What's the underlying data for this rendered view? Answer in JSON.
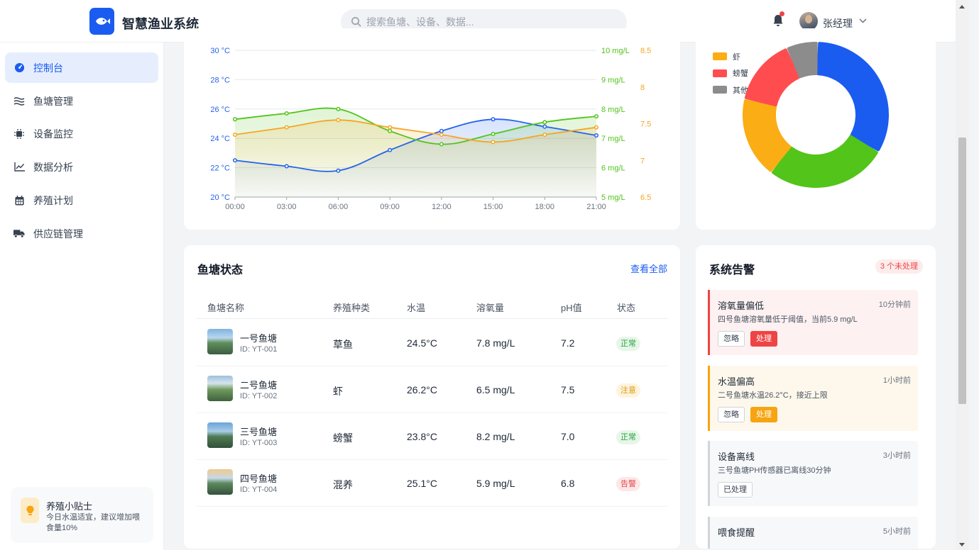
{
  "header": {
    "app_title": "智慧渔业系统",
    "search_placeholder": "搜索鱼塘、设备、数据...",
    "user_name": "张经理",
    "brand_color": "#1a5cf0"
  },
  "sidebar": {
    "items": [
      {
        "label": "控制台",
        "icon": "dashboard-icon",
        "active": true
      },
      {
        "label": "鱼塘管理",
        "icon": "water-waves-icon"
      },
      {
        "label": "设备监控",
        "icon": "chip-icon"
      },
      {
        "label": "数据分析",
        "icon": "line-chart-icon"
      },
      {
        "label": "养殖计划",
        "icon": "calendar-icon"
      },
      {
        "label": "供应链管理",
        "icon": "truck-icon"
      }
    ],
    "tip": {
      "title": "养殖小贴士",
      "text": "今日水温适宜，建议增加喂食量10%"
    }
  },
  "chart_data": [
    {
      "type": "line",
      "x": [
        "00:00",
        "03:00",
        "06:00",
        "09:00",
        "12:00",
        "15:00",
        "18:00",
        "21:00"
      ],
      "y_axes": {
        "temperature": {
          "ticks": [
            "20 °C",
            "22 °C",
            "24 °C",
            "26 °C",
            "28 °C",
            "30 °C"
          ],
          "range": [
            20,
            30
          ],
          "color": "#2563eb"
        },
        "oxygen": {
          "ticks": [
            "5 mg/L",
            "6 mg/L",
            "7 mg/L",
            "8 mg/L",
            "9 mg/L",
            "10 mg/L"
          ],
          "range": [
            5,
            10
          ],
          "color": "#52c41a"
        },
        "ph": {
          "ticks": [
            "6.5",
            "7",
            "7.5",
            "8",
            "8.5"
          ],
          "range": [
            6.5,
            8.5
          ],
          "color": "#f5a623"
        }
      },
      "series": [
        {
          "axis": "temperature",
          "color": "#2563eb",
          "values": [
            22.5,
            22.1,
            21.8,
            23.2,
            24.5,
            25.3,
            24.8,
            24.2
          ]
        },
        {
          "axis": "oxygen",
          "color": "#52c41a",
          "values": [
            7.65,
            7.85,
            8.0,
            7.25,
            6.8,
            7.15,
            7.55,
            7.75
          ]
        },
        {
          "axis": "ph",
          "color": "#f5a623",
          "values": [
            7.35,
            7.45,
            7.55,
            7.45,
            7.35,
            7.25,
            7.35,
            7.45
          ]
        }
      ],
      "grid": true
    },
    {
      "type": "pie",
      "donut": true,
      "categories": [
        "虾",
        "螃蟹",
        "其他"
      ],
      "legend": [
        {
          "label": "虾",
          "color": "#faad14"
        },
        {
          "label": "螃蟹",
          "color": "#ff4d4f"
        },
        {
          "label": "其他",
          "color": "#8c8c8c"
        }
      ],
      "values": [
        33,
        27,
        18,
        15,
        7
      ],
      "colors": [
        "#1a5cf0",
        "#52c41a",
        "#faad14",
        "#ff4d4f",
        "#8c8c8c"
      ],
      "legend_placement": "top-left"
    }
  ],
  "ponds": {
    "title": "鱼塘状态",
    "view_all": "查看全部",
    "columns": [
      "鱼塘名称",
      "养殖种类",
      "水温",
      "溶氧量",
      "pH值",
      "状态"
    ],
    "rows": [
      {
        "name": "一号鱼塘",
        "id": "ID: YT-001",
        "species": "草鱼",
        "temp": "24.5°C",
        "oxygen": "7.8 mg/L",
        "ph": "7.2",
        "status": "正常",
        "status_type": "ok"
      },
      {
        "name": "二号鱼塘",
        "id": "ID: YT-002",
        "species": "虾",
        "temp": "26.2°C",
        "oxygen": "6.5 mg/L",
        "ph": "7.5",
        "status": "注意",
        "status_type": "warn"
      },
      {
        "name": "三号鱼塘",
        "id": "ID: YT-003",
        "species": "螃蟹",
        "temp": "23.8°C",
        "oxygen": "8.2 mg/L",
        "ph": "7.0",
        "status": "正常",
        "status_type": "ok"
      },
      {
        "name": "四号鱼塘",
        "id": "ID: YT-004",
        "species": "混养",
        "temp": "25.1°C",
        "oxygen": "5.9 mg/L",
        "ph": "6.8",
        "status": "告警",
        "status_type": "alarm"
      }
    ]
  },
  "alerts": {
    "title": "系统告警",
    "badge": "3 个未处理",
    "items": [
      {
        "title": "溶氧量偏低",
        "time": "10分钟前",
        "text": "四号鱼塘溶氧量低于阈值，当前5.9 mg/L",
        "buttons": [
          "忽略",
          "处理"
        ],
        "color": "#ef4444",
        "bg": "#fdf1f1"
      },
      {
        "title": "水温偏高",
        "time": "1小时前",
        "text": "二号鱼塘水温26.2°C，接近上限",
        "buttons": [
          "忽略",
          "处理"
        ],
        "color": "#f6a411",
        "bg": "#fef8ec"
      },
      {
        "title": "设备离线",
        "time": "3小时前",
        "text": "三号鱼塘PH传感器已离线30分钟",
        "buttons": [
          "已处理"
        ],
        "color": "#d1d5db",
        "bg": "#f7f8fa"
      },
      {
        "title": "喂食提醒",
        "time": "5小时前",
        "text": "",
        "buttons": [],
        "color": "#d1d5db",
        "bg": "#f7f8fa"
      }
    ]
  }
}
